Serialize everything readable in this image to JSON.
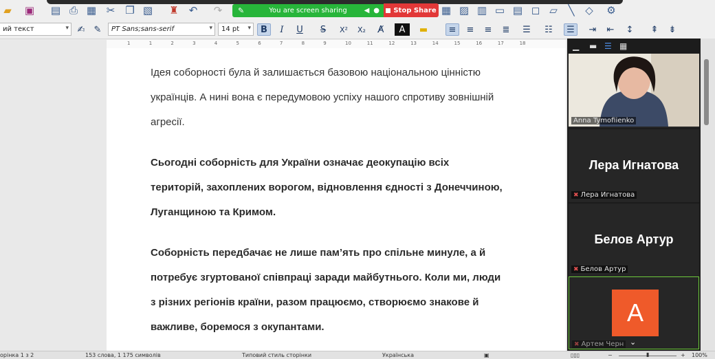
{
  "screen_share": {
    "banner_text": "You are screen sharing",
    "stop_label": "Stop Share"
  },
  "format_bar": {
    "paragraph_style": "ий текст",
    "font_name": "PT Sans;sans-serif",
    "font_size": "14 pt",
    "bold_label": "B",
    "italic_label": "I",
    "underline_label": "U",
    "strike_label": "S",
    "superscript_label": "X²",
    "subscript_label": "X₂"
  },
  "ruler": {
    "marks": [
      "1",
      "1",
      "2",
      "3",
      "4",
      "5",
      "6",
      "7",
      "8",
      "9",
      "10",
      "11",
      "12",
      "13",
      "14",
      "15",
      "16",
      "17",
      "18"
    ]
  },
  "document": {
    "paragraphs": [
      {
        "bold": false,
        "lines": [
          "Ідея соборності була й залишається базовою національною цінністю",
          "українців. А нині вона є передумовою успіху нашого спротиву зовнішній",
          "агресії."
        ]
      },
      {
        "bold": true,
        "lines": [
          "Сьогодні соборність для України означає деокупацію всіх",
          "територій, захоплених ворогом, відновлення єдності з Донеччиною,",
          "Луганщиною та Кримом."
        ]
      },
      {
        "bold": true,
        "lines": [
          "Соборність передбачає не лише пам’ять про спільне минуле, а й",
          "потребує згуртованої співпраці заради майбутнього. Коли ми, люди",
          "з різних регіонів країни, разом працюємо, створюємо знакове й",
          "важливе, боремося з окупантами."
        ]
      }
    ]
  },
  "status_bar": {
    "page": "орінка 1 з 2",
    "words": "153 слова, 1 175 символів",
    "page_style": "Типовий стиль сторінки",
    "language": "Українська",
    "zoom": "100%"
  },
  "participants": [
    {
      "name": "Anna Tymofiienko",
      "has_video": true
    },
    {
      "name": "Лера Игнатова",
      "display": "Лера Игнатова",
      "has_video": false
    },
    {
      "name": "Белов Артур",
      "display": "Белов Артур",
      "has_video": false
    },
    {
      "name": "Артем Черн",
      "avatar_letter": "A",
      "has_video": false
    }
  ],
  "colors": {
    "share_green": "#27b53a",
    "stop_red": "#e23838",
    "avatar_orange": "#ef5a2a",
    "panel_bg": "#1c1c1c"
  }
}
